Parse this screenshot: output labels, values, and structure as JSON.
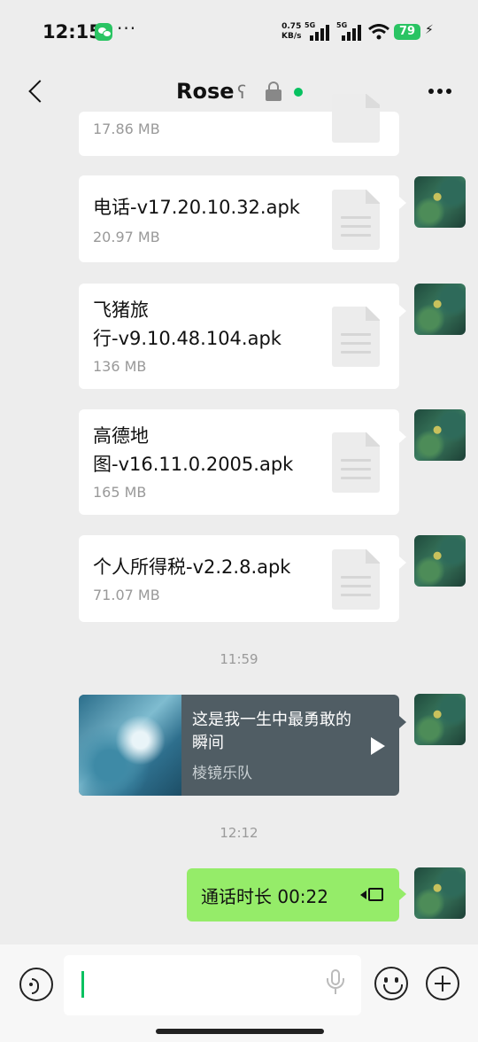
{
  "status_bar": {
    "time": "12:15",
    "overflow": "···",
    "speed_value": "0.75",
    "speed_unit": "KB/s",
    "net1": "5G",
    "net2": "5G",
    "battery": "79",
    "icons": [
      "wechat-icon",
      "signal-icon",
      "wifi-icon",
      "battery-icon",
      "charging-icon"
    ]
  },
  "header": {
    "contact_name": "Rose",
    "icons": [
      "back-icon",
      "ear-icon",
      "lock-icon",
      "online-dot",
      "more-icon"
    ],
    "online_color": "#07c160"
  },
  "messages": [
    {
      "type": "file",
      "name": "",
      "size": "17.86 MB"
    },
    {
      "type": "file",
      "name": "电话-v17.20.10.32.apk",
      "size": "20.97 MB"
    },
    {
      "type": "file",
      "name_line1": "飞猪旅",
      "name_line2": "行-v9.10.48.104.apk",
      "size": "136 MB"
    },
    {
      "type": "file",
      "name_line1": "高德地",
      "name_line2": "图-v16.11.0.2005.apk",
      "size": "165 MB"
    },
    {
      "type": "file",
      "name": "个人所得税-v2.2.8.apk",
      "size": "71.07 MB"
    }
  ],
  "time_labels": [
    "11:59",
    "12:12"
  ],
  "music": {
    "title": "这是我一生中最勇敢的瞬间",
    "artist": "棱镜乐队",
    "icon": "play-icon"
  },
  "call": {
    "text": "通话时长 00:22",
    "icon": "video-call-icon",
    "bubble_color": "#95ec69"
  },
  "input_bar": {
    "value": "",
    "icons": [
      "voice-icon",
      "mic-icon",
      "emoji-icon",
      "plus-icon"
    ]
  },
  "colors": {
    "background": "#ededed",
    "accent": "#07c160"
  }
}
